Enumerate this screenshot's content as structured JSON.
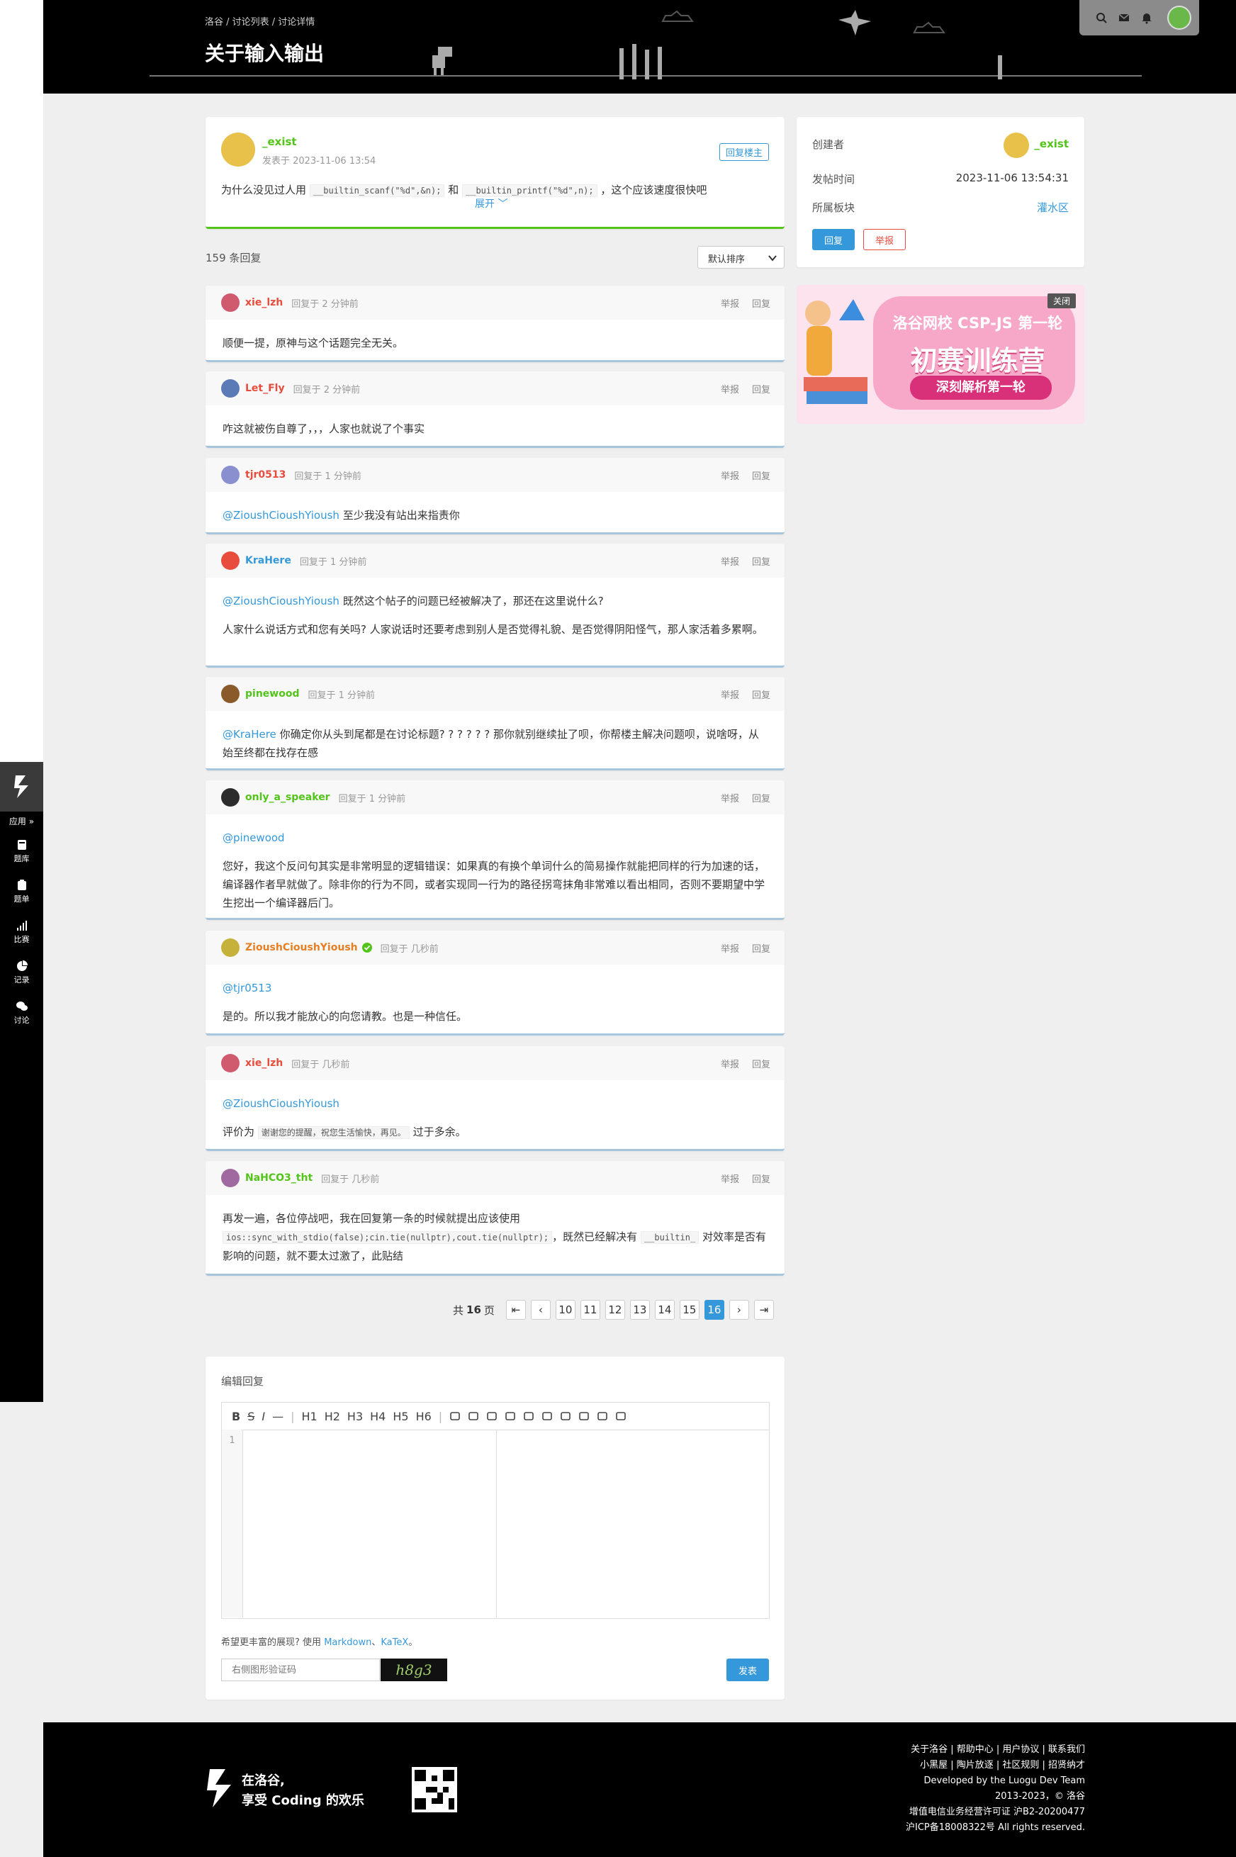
{
  "header": {
    "breadcrumb": "洛谷 / 讨论列表 / 讨论详情",
    "title": "关于输入输出"
  },
  "sidebar": {
    "apps_label": "应用 »",
    "items": [
      {
        "label": "题库",
        "icon": "book-icon"
      },
      {
        "label": "题单",
        "icon": "list-icon"
      },
      {
        "label": "比赛",
        "icon": "bar-chart-icon"
      },
      {
        "label": "记录",
        "icon": "pie-chart-icon"
      },
      {
        "label": "讨论",
        "icon": "chat-icon"
      }
    ]
  },
  "post": {
    "author": "_exist",
    "time": "发表于 2023-11-06 13:54",
    "reply_author_btn": "回复楼主",
    "text_pre": "为什么没见过人用",
    "code1": "__builtin_scanf(\"%d\",&n);",
    "text_mid": "和",
    "code2": "__builtin_printf(\"%d\",n);",
    "text_post": "，这个应该速度很快吧",
    "expand": "展开 ﹀"
  },
  "info": {
    "creator_label": "创建者",
    "creator": "_exist",
    "time_label": "发帖时间",
    "time": "2023-11-06 13:54:31",
    "board_label": "所属板块",
    "board": "灌水区",
    "reply_btn": "回复",
    "report_btn": "举报"
  },
  "ad": {
    "close": "关闭",
    "line1": "洛谷网校 CSP-JS 第一轮",
    "line2": "初赛训练营",
    "line3": "深刻解析第一轮"
  },
  "list": {
    "count": "159 条回复",
    "sort": "默认排序"
  },
  "actions": {
    "report": "举报",
    "reply": "回复"
  },
  "replies": [
    {
      "user": "xie_lzh",
      "time": "回复于 2 分钟前",
      "paras": [
        "顺便一提，原神与这个话题完全无关。"
      ]
    },
    {
      "user": "Let_Fly",
      "time": "回复于 2 分钟前",
      "paras": [
        "咋这就被伤自尊了，，，人家也就说了个事实"
      ]
    },
    {
      "user": "tjr0513",
      "time": "回复于 1 分钟前",
      "mention": "@ZioushCioushYioush",
      "paras": [
        "至少我没有站出来指责你"
      ]
    },
    {
      "user": "KraHere",
      "time": "回复于 1 分钟前",
      "mention": "@ZioushCioushYioush",
      "paras": [
        "既然这个帖子的问题已经被解决了，那还在这里说什么?",
        "人家什么说话方式和您有关吗? 人家说话时还要考虑到别人是否觉得礼貌、是否觉得阴阳怪气，那人家活着多累啊。"
      ]
    },
    {
      "user": "pinewood",
      "time": "回复于 1 分钟前",
      "mention": "@KraHere",
      "paras": [
        "你确定你从头到尾都是在讨论标题? ? ? ? ? ? 那你就别继续扯了呗，你帮楼主解决问题呗，说啥呀，从始至终都在找存在感"
      ]
    },
    {
      "user": "only_a_speaker",
      "time": "回复于 1 分钟前",
      "mention_line": "@pinewood",
      "paras": [
        "您好，我这个反问句其实是非常明显的逻辑错误：如果真的有换个单词什么的简易操作就能把同样的行为加速的话，编译器作者早就做了。除非你的行为不同，或者实现同一行为的路径拐弯抹角非常难以看出相同，否则不要期望中学生挖出一个编译器后门。"
      ]
    },
    {
      "user": "ZioushCioushYioush",
      "time": "回复于 几秒前",
      "mention_line": "@tjr0513",
      "paras": [
        "是的。所以我才能放心的向您请教。也是一种信任。"
      ]
    },
    {
      "user": "xie_lzh",
      "time": "回复于 几秒前",
      "mention_line": "@ZioushCioushYioush",
      "paras": [
        "评价为"
      ],
      "code": "谢谢您的提醒，祝您生活愉快，再见。",
      "after": "过于多余。"
    },
    {
      "user": "NaHCO3_tht",
      "time": "回复于 几秒前",
      "paras": [
        "再发一遍，各位停战吧，我在回复第一条的时候就提出应该使用"
      ],
      "code_a": "ios::sync_with_stdio(false);cin.tie(nullptr),cout.tie(nullptr);",
      "mid": "，既然已经解决有",
      "code_b": "__builtin_",
      "after": "对效率是否有影响的问题，就不要太过激了，此贴结"
    }
  ],
  "pager": {
    "total_pre": "共",
    "total": "16",
    "total_post": "页",
    "pages": [
      "10",
      "11",
      "12",
      "13",
      "14",
      "15",
      "16"
    ],
    "current": "16"
  },
  "editor": {
    "title": "编辑回复",
    "toolbar": [
      "B",
      "S",
      "I",
      "—",
      "|",
      "H1",
      "H2",
      "H3",
      "H4",
      "H5",
      "H6"
    ],
    "line_no": "1",
    "hint_pre": "希望更丰富的展现? 使用",
    "hint_md": "Markdown",
    "hint_sep": "、",
    "hint_katex": "KaTeX",
    "hint_end": "。",
    "captcha_placeholder": "右侧图形验证码",
    "captcha_img": "h8g3",
    "submit": "发表"
  },
  "footer": {
    "slogan1": "在洛谷,",
    "slogan2": "享受 Coding 的欢乐",
    "links": "关于洛谷 | 帮助中心 | 用户协议 | 联系我们",
    "links2": "小黑屋 | 陶片放逐 | 社区规则 | 招贤纳才",
    "dev": "Developed by the Luogu Dev Team",
    "copy": "2013-2023，© 洛谷",
    "license": "增值电信业务经营许可证 沪B2-20200477",
    "icp": "沪ICP备18008322号 All rights reserved."
  },
  "colors": {
    "accent": "#3498db",
    "green": "#52c41a",
    "red": "#e74c3c",
    "orange": "#e67e22"
  }
}
